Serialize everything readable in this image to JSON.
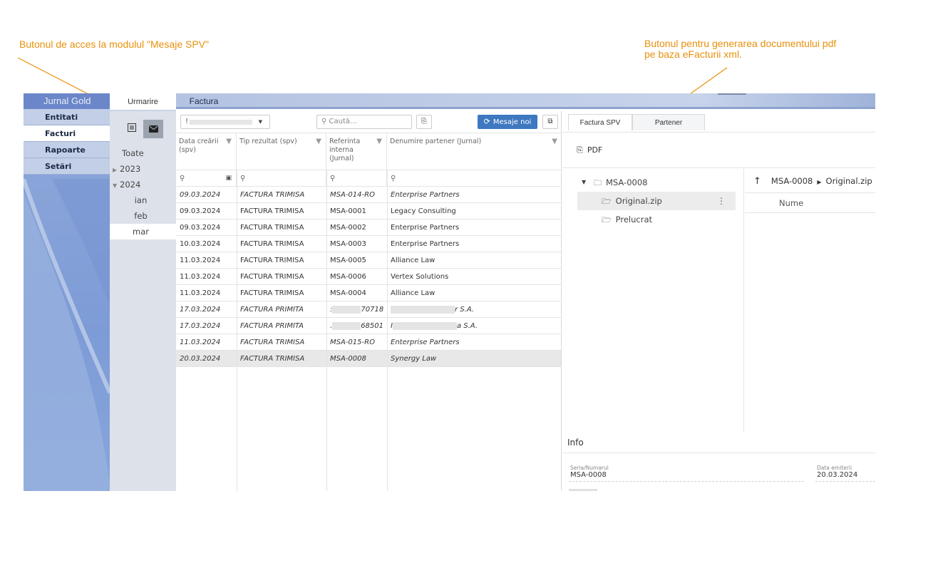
{
  "annotations": {
    "left": "Butonul de acces la modulul \"Mesaje SPV\"",
    "right_line1": "Butonul pentru generarea documentului pdf",
    "right_line2": "pe baza eFacturii xml."
  },
  "nav": {
    "title": "Jurnal Gold",
    "items": [
      {
        "label": "Entitati"
      },
      {
        "label": "Facturi"
      },
      {
        "label": "Rapoarte"
      },
      {
        "label": "Setări"
      }
    ]
  },
  "tree": {
    "tab": "Urmarire",
    "list_icon": "list-view-icon",
    "mail_icon": "envelope-icon",
    "root": "Toate",
    "years": [
      "2023",
      "2024"
    ],
    "months": [
      "ian",
      "feb",
      "mar"
    ]
  },
  "main": {
    "tab": "Factura"
  },
  "grid": {
    "dropdown_value": "!",
    "search_placeholder": "Caută...",
    "mesaje_button": "Mesaje noi",
    "columns": {
      "data": "Data creării (spv)",
      "tip": "Tip rezultat (spv)",
      "ref": "Referinta interna (Jurnal)",
      "partener": "Denumire partener (Jurnal)"
    },
    "rows": [
      {
        "data": "09.03.2024",
        "tip": "FACTURA TRIMISA",
        "ref": "MSA-014-RO",
        "partener": "Enterprise Partners"
      },
      {
        "data": "09.03.2024",
        "tip": "FACTURA TRIMISA",
        "ref": "MSA-0001",
        "partener": "Legacy Consulting"
      },
      {
        "data": "09.03.2024",
        "tip": "FACTURA TRIMISA",
        "ref": "MSA-0002",
        "partener": "Enterprise Partners"
      },
      {
        "data": "10.03.2024",
        "tip": "FACTURA TRIMISA",
        "ref": "MSA-0003",
        "partener": "Enterprise Partners"
      },
      {
        "data": "11.03.2024",
        "tip": "FACTURA TRIMISA",
        "ref": "MSA-0005",
        "partener": "Alliance Law"
      },
      {
        "data": "11.03.2024",
        "tip": "FACTURA TRIMISA",
        "ref": "MSA-0006",
        "partener": "Vertex Solutions"
      },
      {
        "data": "11.03.2024",
        "tip": "FACTURA TRIMISA",
        "ref": "MSA-0004",
        "partener": "Alliance Law"
      },
      {
        "data": "17.03.2024",
        "tip": "FACTURA PRIMITA",
        "ref_prefix": ":",
        "ref": "70718",
        "partener_prefix": "",
        "partener": "r S.A."
      },
      {
        "data": "17.03.2024",
        "tip": "FACTURA PRIMITA",
        "ref_prefix": ".",
        "ref": "68501",
        "partener_prefix": "I",
        "partener": "a S.A."
      },
      {
        "data": "11.03.2024",
        "tip": "FACTURA TRIMISA",
        "ref": "MSA-015-RO",
        "partener": "Enterprise Partners"
      },
      {
        "data": "20.03.2024",
        "tip": "FACTURA TRIMISA",
        "ref": "MSA-0008",
        "partener": "Synergy Law"
      }
    ]
  },
  "right": {
    "tabs": [
      "Factura SPV",
      "Partener"
    ],
    "pdf_label": "PDF",
    "folder": "MSA-0008",
    "subfolders": [
      "Original.zip",
      "Prelucrat"
    ],
    "path": [
      "MSA-0008",
      "Original.zip"
    ],
    "list_header": "Nume",
    "info_title": "Info",
    "fields": [
      {
        "label": "Seria/Numarul",
        "value": "MSA-0008"
      },
      {
        "label": "Data emiterii",
        "value": "20.03.2024"
      }
    ]
  },
  "colors": {
    "annotation": "#e8900c",
    "accent": "#3d78c0",
    "nav": "#7d9bd6"
  }
}
